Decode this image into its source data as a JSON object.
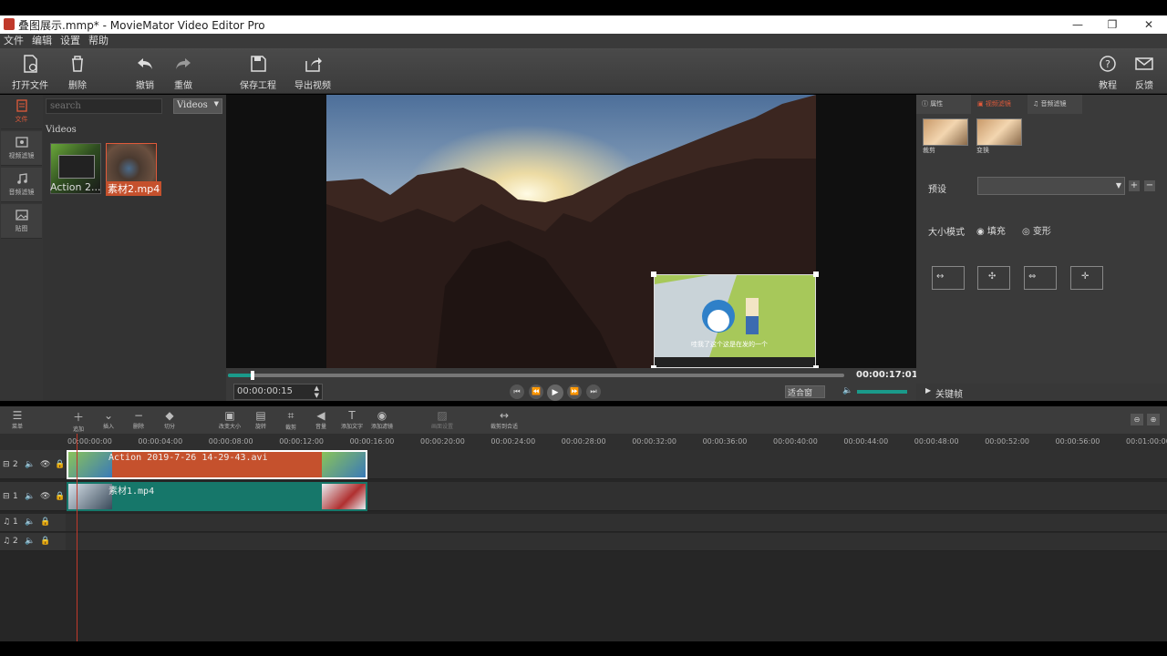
{
  "window": {
    "title": "叠图展示.mmp* - MovieMator Video Editor Pro"
  },
  "menu": [
    "文件",
    "编辑",
    "设置",
    "帮助"
  ],
  "toolbar": {
    "open": "打开文件",
    "delete": "删除",
    "undo": "撤销",
    "redo": "重做",
    "save": "保存工程",
    "export": "导出视频",
    "tutorial": "教程",
    "feedback": "反馈"
  },
  "leftnav": [
    "文件",
    "视频滤镜",
    "音频滤镜",
    "贴图"
  ],
  "library": {
    "search_placeholder": "search",
    "filter": "Videos",
    "section": "Videos",
    "items": [
      {
        "label": "Action 2..."
      },
      {
        "label": "素材2.mp4"
      }
    ]
  },
  "preview": {
    "timecode": "00:00:00:15",
    "duration": "00:00:17:01",
    "fit": "适合窗",
    "progress": 0.04,
    "overlay_caption": "哇我了这个这是在发的一个"
  },
  "right": {
    "tabs": [
      "属性",
      "视频滤镜",
      "音频滤镜"
    ],
    "filters": [
      {
        "label": "裁剪"
      },
      {
        "label": "变换"
      }
    ],
    "preset_label": "预设",
    "size_mode_label": "大小模式",
    "fill_label": "填充",
    "transform_label": "变形",
    "keyframe": "关键帧"
  },
  "timeline_tools": [
    "菜单",
    "追加",
    "插入",
    "删除",
    "切分",
    "改变大小",
    "旋转",
    "裁剪",
    "音量",
    "添加文字",
    "添加滤镜",
    "画面设置",
    "裁剪到合适"
  ],
  "ruler": [
    "00:00:00:00",
    "00:00:04:00",
    "00:00:08:00",
    "00:00:12:00",
    "00:00:16:00",
    "00:00:20:00",
    "00:00:24:00",
    "00:00:28:00",
    "00:00:32:00",
    "00:00:36:00",
    "00:00:40:00",
    "00:00:44:00",
    "00:00:48:00",
    "00:00:52:00",
    "00:00:56:00",
    "00:01:00:00"
  ],
  "tracks": [
    {
      "label": "2",
      "clip": "Action 2019-7-26 14-29-43.avi",
      "color": "#c5512d"
    },
    {
      "label": "1",
      "clip": "素材1.mp4",
      "color": "#16776a"
    },
    {
      "label": "1"
    },
    {
      "label": "2"
    }
  ]
}
